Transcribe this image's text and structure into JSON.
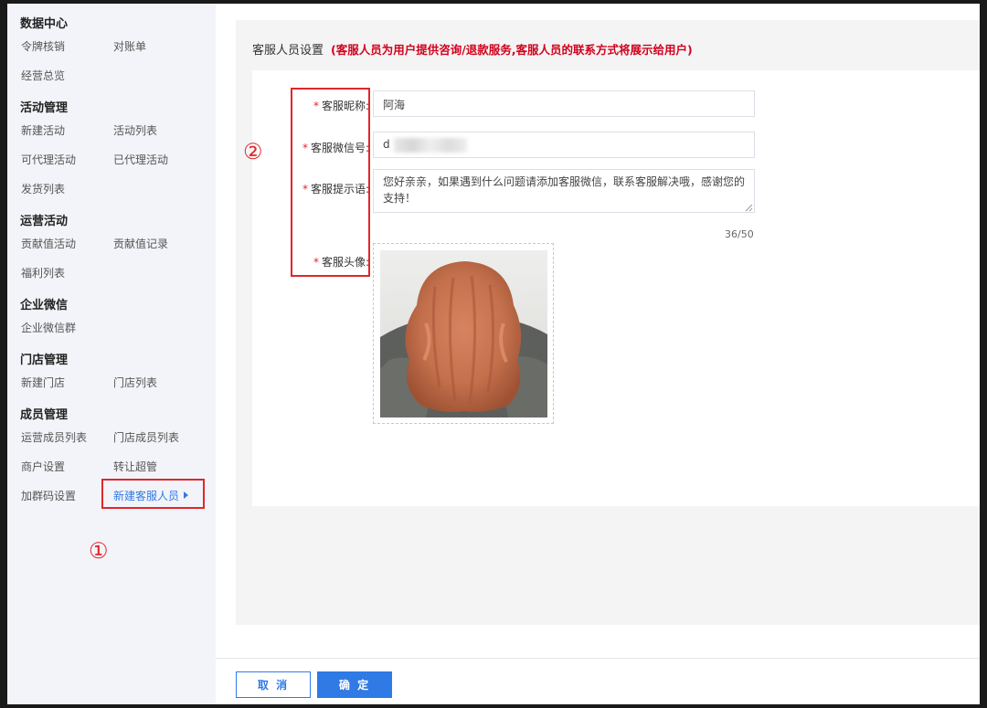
{
  "sidebar": {
    "sections": [
      {
        "title": "数据中心",
        "items": [
          "令牌核销",
          "对账单",
          "经营总览"
        ]
      },
      {
        "title": "活动管理",
        "items": [
          "新建活动",
          "活动列表",
          "可代理活动",
          "已代理活动",
          "发货列表"
        ]
      },
      {
        "title": "运营活动",
        "items": [
          "贡献值活动",
          "贡献值记录",
          "福利列表"
        ]
      },
      {
        "title": "企业微信",
        "items": [
          "企业微信群"
        ]
      },
      {
        "title": "门店管理",
        "items": [
          "新建门店",
          "门店列表"
        ]
      },
      {
        "title": "成员管理",
        "items": [
          "运营成员列表",
          "门店成员列表",
          "商户设置",
          "转让超管",
          "加群码设置",
          "新建客服人员"
        ]
      }
    ],
    "active_item": "新建客服人员"
  },
  "annotations": {
    "one": "①",
    "two": "②"
  },
  "header": {
    "title": "客服人员设置",
    "note": "(客服人员为用户提供咨询/退款服务,客服人员的联系方式将展示给用户)"
  },
  "form": {
    "required_mark": "*",
    "nickname": {
      "label": "客服昵称:",
      "value": "阿海"
    },
    "wechat": {
      "label": "客服微信号:",
      "value": "d"
    },
    "tip": {
      "label": "客服提示语:",
      "value": "您好亲亲，如果遇到什么问题请添加客服微信，联系客服解决哦，感谢您的支持！",
      "counter": "36/50"
    },
    "avatar": {
      "label": "客服头像:"
    }
  },
  "footer": {
    "cancel": "取 消",
    "confirm": "确 定"
  },
  "colors": {
    "accent": "#2f7ae5",
    "annotation": "#e0262a",
    "note": "#d0021b"
  }
}
